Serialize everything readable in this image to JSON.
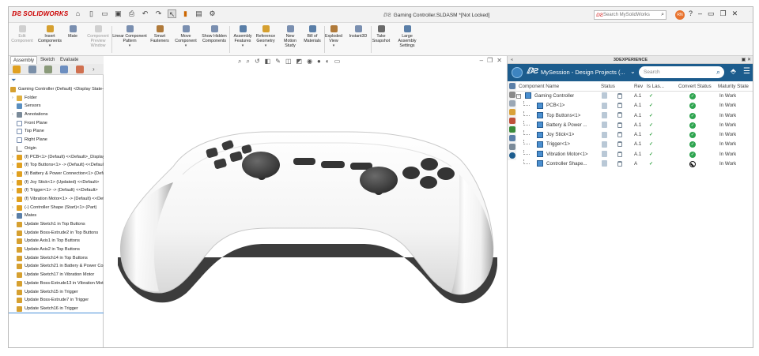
{
  "app": {
    "brand": "SOLIDWORKS",
    "document_title": "Gaming Controller.SLDASM *[Not Locked]",
    "search_placeholder": "Search MySolidWorks",
    "user_initials": "RN"
  },
  "ribbon": {
    "buttons": [
      {
        "label": "Edit Component",
        "disabled": true
      },
      {
        "label": "Insert Components",
        "disabled": false
      },
      {
        "label": "Mate",
        "disabled": false
      },
      {
        "label": "Component Preview Window",
        "disabled": true
      },
      {
        "label": "Linear Component Pattern",
        "disabled": false
      },
      {
        "label": "Smart Fasteners",
        "disabled": false
      },
      {
        "label": "Move Component",
        "disabled": false
      },
      {
        "label": "Show Hidden Components",
        "disabled": false
      },
      {
        "label": "Assembly Features",
        "disabled": false
      },
      {
        "label": "Reference Geometry",
        "disabled": false
      },
      {
        "label": "New Motion Study",
        "disabled": false
      },
      {
        "label": "Bill of Materials",
        "disabled": false
      },
      {
        "label": "Exploded View",
        "disabled": false
      },
      {
        "label": "Instant3D",
        "disabled": false
      },
      {
        "label": "Take Snapshot",
        "disabled": false
      },
      {
        "label": "Large Assembly Settings",
        "disabled": false
      }
    ]
  },
  "tabs": [
    "Assembly",
    "Sketch",
    "Evaluate"
  ],
  "tree": {
    "items": [
      {
        "label": "Gaming Controller (Default) <Display State-1>",
        "expander": "",
        "icon": "assembly"
      },
      {
        "label": "Folder",
        "expander": "›",
        "icon": "folder"
      },
      {
        "label": "Sensors",
        "expander": "",
        "icon": "sensor"
      },
      {
        "label": "Annotations",
        "expander": "›",
        "icon": "annotation"
      },
      {
        "label": "Front Plane",
        "expander": "",
        "icon": "plane"
      },
      {
        "label": "Top Plane",
        "expander": "",
        "icon": "plane"
      },
      {
        "label": "Right Plane",
        "expander": "",
        "icon": "plane"
      },
      {
        "label": "Origin",
        "expander": "",
        "icon": "origin"
      },
      {
        "label": "(f) PCB<1> (Default) <<Default>_Display",
        "expander": "›",
        "icon": "part"
      },
      {
        "label": "(f) Top Buttons<1> -> (Default) <<Default>",
        "expander": "›",
        "icon": "part"
      },
      {
        "label": "(f) Battery & Power Connection<1> (Default)",
        "expander": "›",
        "icon": "part"
      },
      {
        "label": "(f) Joy Stick<1> (Updated) <<Default>",
        "expander": "›",
        "icon": "part"
      },
      {
        "label": "(f) Trigger<1> -> (Default) <<Default>",
        "expander": "›",
        "icon": "part"
      },
      {
        "label": "(f) Vibration Motor<1> -> (Default) <<Default>",
        "expander": "›",
        "icon": "part"
      },
      {
        "label": "(-) Controller Shape (Start)<1> (Part)",
        "expander": "›",
        "icon": "part"
      },
      {
        "label": "Mates",
        "expander": "›",
        "icon": "mates"
      },
      {
        "label": "Update Sketch1 in Top Buttons",
        "expander": "",
        "icon": "update"
      },
      {
        "label": "Update Boss-Extrude2 in Top Buttons",
        "expander": "",
        "icon": "update"
      },
      {
        "label": "Update Axis1 in Top Buttons",
        "expander": "",
        "icon": "update"
      },
      {
        "label": "Update Axis2 in Top Buttons",
        "expander": "",
        "icon": "update"
      },
      {
        "label": "Update Sketch14 in Top Buttons",
        "expander": "",
        "icon": "update"
      },
      {
        "label": "Update Sketch21 in Battery & Power Connection",
        "expander": "",
        "icon": "update"
      },
      {
        "label": "Update Sketch17 in Vibration Motor",
        "expander": "",
        "icon": "update"
      },
      {
        "label": "Update Boss-Extrude13 in Vibration Motor",
        "expander": "",
        "icon": "update"
      },
      {
        "label": "Update Sketch15 in Trigger",
        "expander": "",
        "icon": "update"
      },
      {
        "label": "Update Boss-Extrude7 in Trigger",
        "expander": "",
        "icon": "update"
      },
      {
        "label": "Update Sketch16 in Trigger",
        "expander": "",
        "icon": "update"
      }
    ]
  },
  "panel": {
    "header": "3DEXPERIENCE",
    "session": "MySession - Design Projects (...",
    "search_placeholder": "Search",
    "columns": [
      "Component Name",
      "Status",
      "Rev",
      "Is Las...",
      "Convert Status",
      "Maturity State"
    ],
    "rows": [
      {
        "name": "Gaming Controller",
        "rev": "A.1",
        "latest": "✓",
        "convert": "ok",
        "maturity": "In Work",
        "level": 0
      },
      {
        "name": "PCB<1>",
        "rev": "A.1",
        "latest": "✓",
        "convert": "ok",
        "maturity": "In Work",
        "level": 1
      },
      {
        "name": "Top Buttons<1>",
        "rev": "A.1",
        "latest": "✓",
        "convert": "ok",
        "maturity": "In Work",
        "level": 1
      },
      {
        "name": "Battery & Power ...",
        "rev": "A.1",
        "latest": "✓",
        "convert": "ok",
        "maturity": "In Work",
        "level": 1
      },
      {
        "name": "Joy Stick<1>",
        "rev": "A.1",
        "latest": "✓",
        "convert": "ok",
        "maturity": "In Work",
        "level": 1
      },
      {
        "name": "Trigger<1>",
        "rev": "A.1",
        "latest": "✓",
        "convert": "ok",
        "maturity": "In Work",
        "level": 1
      },
      {
        "name": "Vibration Motor<1>",
        "rev": "A.1",
        "latest": "✓",
        "convert": "ok",
        "maturity": "In Work",
        "level": 1
      },
      {
        "name": "Controller Shape...",
        "rev": "A",
        "latest": "✓",
        "convert": "blocked",
        "maturity": "In Work",
        "level": 1
      }
    ]
  },
  "colors": {
    "accent": "#1c5c8d",
    "brand": "#cc0000",
    "ok": "#2ea44f"
  }
}
